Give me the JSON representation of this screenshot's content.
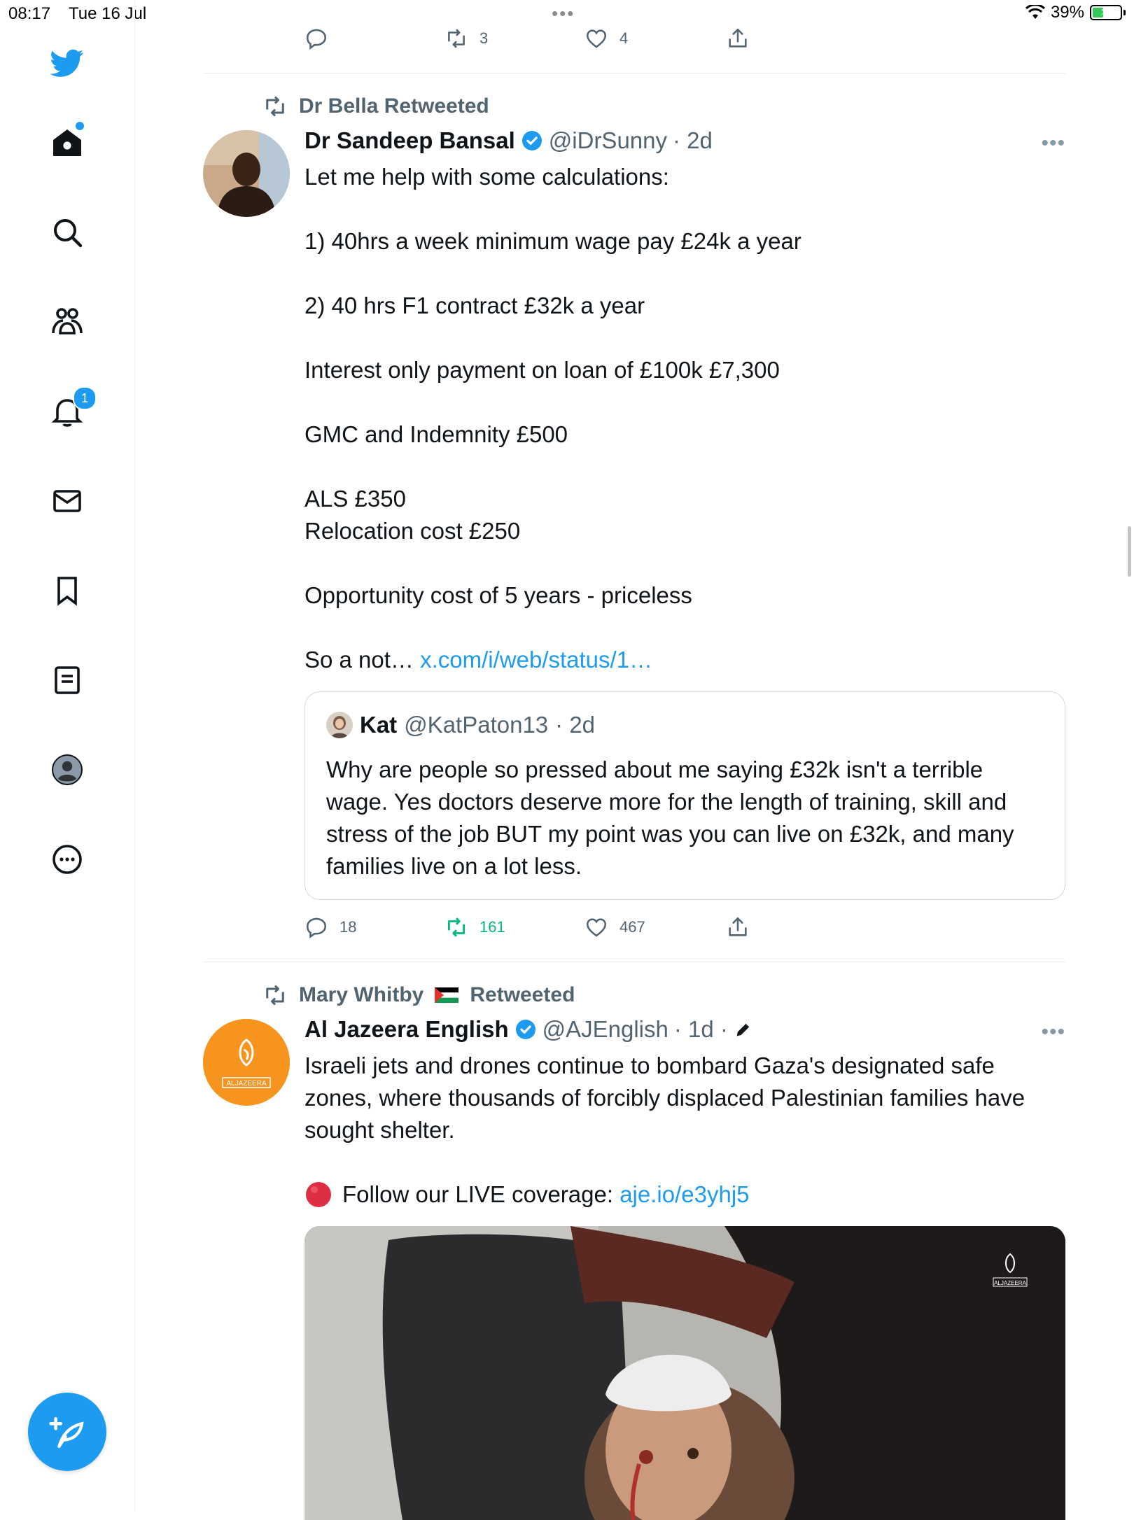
{
  "status_bar": {
    "time": "08:17",
    "date": "Tue 16 Jul",
    "battery": "39%",
    "battery_level": 0.39
  },
  "sidebar": {
    "notifications_badge": "1"
  },
  "prev_tweet_actions": {
    "replies": "",
    "retweets": "3",
    "likes": "4"
  },
  "tweet1": {
    "social_context": "Dr Bella Retweeted",
    "name": "Dr Sandeep Bansal",
    "handle": "@iDrSunny",
    "time": "· 2d",
    "more": "•••",
    "text": "Let me help with some calculations:\n\n1) 40hrs a week minimum wage pay £24k a year\n\n2) 40 hrs F1 contract £32k a year\n\nInterest only payment on loan of £100k £7,300\n\nGMC and Indemnity £500\n\nALS £350\nRelocation cost £250\n\nOpportunity cost of 5 years - priceless\n\nSo a not… ",
    "link": "x.com/i/web/status/1…",
    "quote": {
      "name": "Kat",
      "handle": "@KatPaton13",
      "time": "· 2d",
      "text": "Why are people so pressed about me saying £32k isn't a terrible wage. Yes doctors deserve more for the length of training, skill and stress of the job BUT my point was you can live on £32k, and many families live on a lot less."
    },
    "actions": {
      "replies": "18",
      "retweets": "161",
      "likes": "467"
    }
  },
  "tweet2": {
    "social_context_name": "Mary Whitby",
    "social_context_suffix": "Retweeted",
    "name": "Al Jazeera English",
    "handle": "@AJEnglish",
    "time": "· 1d ·",
    "more": "•••",
    "text": "Israeli jets and drones continue to bombard Gaza's designated safe zones, where thousands of forcibly displaced Palestinian families have sought shelter.",
    "follow_text": "Follow our LIVE coverage: ",
    "follow_link": "aje.io/e3yhj5",
    "avatar_logo_text": "ALJAZEERA",
    "media_watermark": "ALJAZEERA"
  },
  "colors": {
    "accent": "#1d9bf0",
    "retweet_active": "#00ba7c",
    "muted": "#536471"
  }
}
